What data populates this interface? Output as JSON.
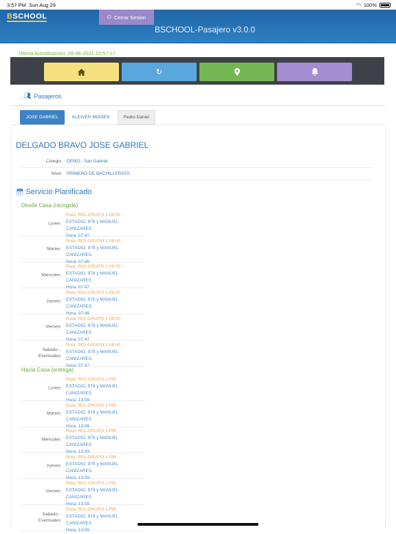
{
  "status": {
    "time": "3:57 PM",
    "date": "Sun Aug 29",
    "battery": "100%"
  },
  "header": {
    "logo_b": "B",
    "logo_rest": "SCHOOL",
    "logout": "Cerrar Sesion",
    "title": "BSCHOOL-Pasajero v3.0.0"
  },
  "update": "Ultima Actualizacion: 29-08-2021 15:57:17",
  "nav": [
    {
      "icon": "home-icon"
    },
    {
      "icon": "refresh-icon"
    },
    {
      "icon": "map-marker-icon"
    },
    {
      "icon": "bell-icon"
    }
  ],
  "section": {
    "title": "Pasajeros"
  },
  "tabs": [
    "JOSE GABRIEL",
    "KLEIVER MOISES",
    "Pedro Daniel"
  ],
  "student": {
    "name": "DELGADO BRAVO JOSE GABRIEL",
    "colegio_label": "Colegio",
    "colegio": "DEMO - San Gabriel",
    "nivel_label": "Nivel",
    "nivel": "PRIMERO DE BACHILLERATO"
  },
  "service": {
    "title": "Servicio Planificado",
    "pickup_title": "Desde Casa (recogida)",
    "dropoff_title": "Hacia Casa (entrega)",
    "pickup": [
      {
        "day": "Lunes",
        "ruta": "Ruta: R02-GRUPO 1-08:00",
        "dir": "ESTADIO, 978 y MANUEL CANIZARES",
        "hora": "Hora: 07:47"
      },
      {
        "day": "Martes",
        "ruta": "Ruta: R02-GRUPO 1-08:00",
        "dir": "ESTADIO, 978 y MANUEL CANIZARES",
        "hora": "Hora: 07:46"
      },
      {
        "day": "Miercoles",
        "ruta": "Ruta: R02-GRUPO 1-08:00",
        "dir": "ESTADIO, 978 y MANUEL CANIZARES",
        "hora": "Hora: 07:47"
      },
      {
        "day": "Jueves",
        "ruta": "Ruta: R02-GRUPO 1-08:00",
        "dir": "ESTADIO, 978 y MANUEL CANIZARES",
        "hora": "Hora: 07:46"
      },
      {
        "day": "Viernes",
        "ruta": "Ruta: R02-GRUPO 1-08:00",
        "dir": "ESTADIO, 978 y MANUEL CANIZARES",
        "hora": "Hora: 07:47"
      },
      {
        "day": "Sabado - Eventuales",
        "ruta": "Ruta: R02-GRUPO 1-08:00",
        "dir": "ESTADIO, 978 y MANUEL CANIZARES",
        "hora": "Hora: 07:47"
      }
    ],
    "dropoff": [
      {
        "day": "Lunes",
        "ruta": "Ruta: R01-GRUPO 1-PM",
        "dir": "ESTADIO, 978 y MANUEL CANIZARES",
        "hora": "Hora: 13:09"
      },
      {
        "day": "Martes",
        "ruta": "Ruta: R01-GRUPO 1-PM",
        "dir": "ESTADIO, 978 y MANUEL CANIZARES",
        "hora": "Hora: 13:09"
      },
      {
        "day": "Miercoles",
        "ruta": "Ruta: R01-GRUPO 1-PM",
        "dir": "ESTADIO, 978 y MANUEL CANIZARES",
        "hora": "Hora: 13:09"
      },
      {
        "day": "Jueves",
        "ruta": "Ruta: R01-GRUPO 1-PM",
        "dir": "ESTADIO, 978 y MANUEL CANIZARES",
        "hora": "Hora: 13:09"
      },
      {
        "day": "Viernes",
        "ruta": "Ruta: R01-GRUPO 1-PM",
        "dir": "ESTADIO, 978 y MANUEL CANIZARES",
        "hora": "Hora: 13:09"
      },
      {
        "day": "Sabado - Eventuales",
        "ruta": "Ruta: R01-GRUPO 1-PM",
        "dir": "ESTADIO, 978 y MANUEL CANIZARES",
        "hora": "Hora: 13:09"
      }
    ]
  }
}
